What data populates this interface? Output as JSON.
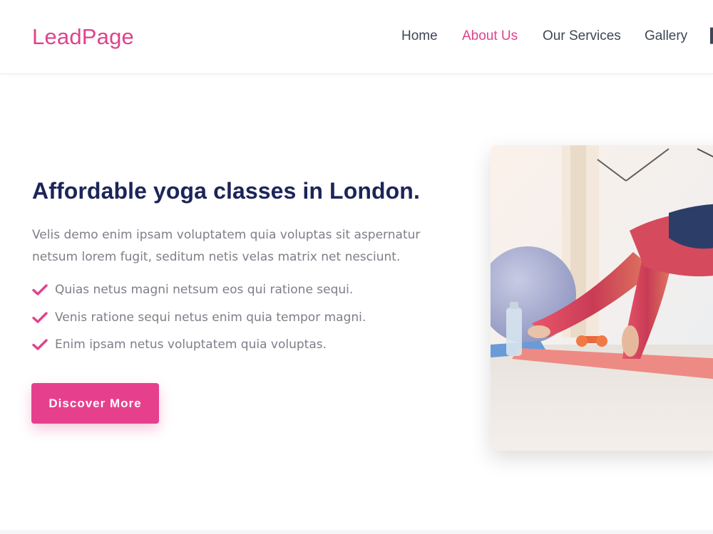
{
  "brand": {
    "name": "LeadPage",
    "accent": "#e0428c",
    "heading_color": "#1c2559"
  },
  "nav": {
    "items": [
      {
        "label": "Home",
        "active": false
      },
      {
        "label": "About Us",
        "active": true
      },
      {
        "label": "Our Services",
        "active": false
      },
      {
        "label": "Gallery",
        "active": false
      },
      {
        "label": "",
        "active": false
      }
    ]
  },
  "hero": {
    "title": "Affordable yoga classes in London.",
    "description": "Velis demo enim ipsam voluptatem quia voluptas sit aspernatur netsum lorem fugit, seditum netis velas matrix net nesciunt.",
    "features": [
      "Quias netus magni netsum eos qui ratione sequi.",
      "Venis ratione sequi netus enim quia tempor magni.",
      "Enim ipsam netus voluptatem quia voluptas."
    ],
    "cta_label": "Discover More",
    "image_icon": "yoga-photo"
  }
}
